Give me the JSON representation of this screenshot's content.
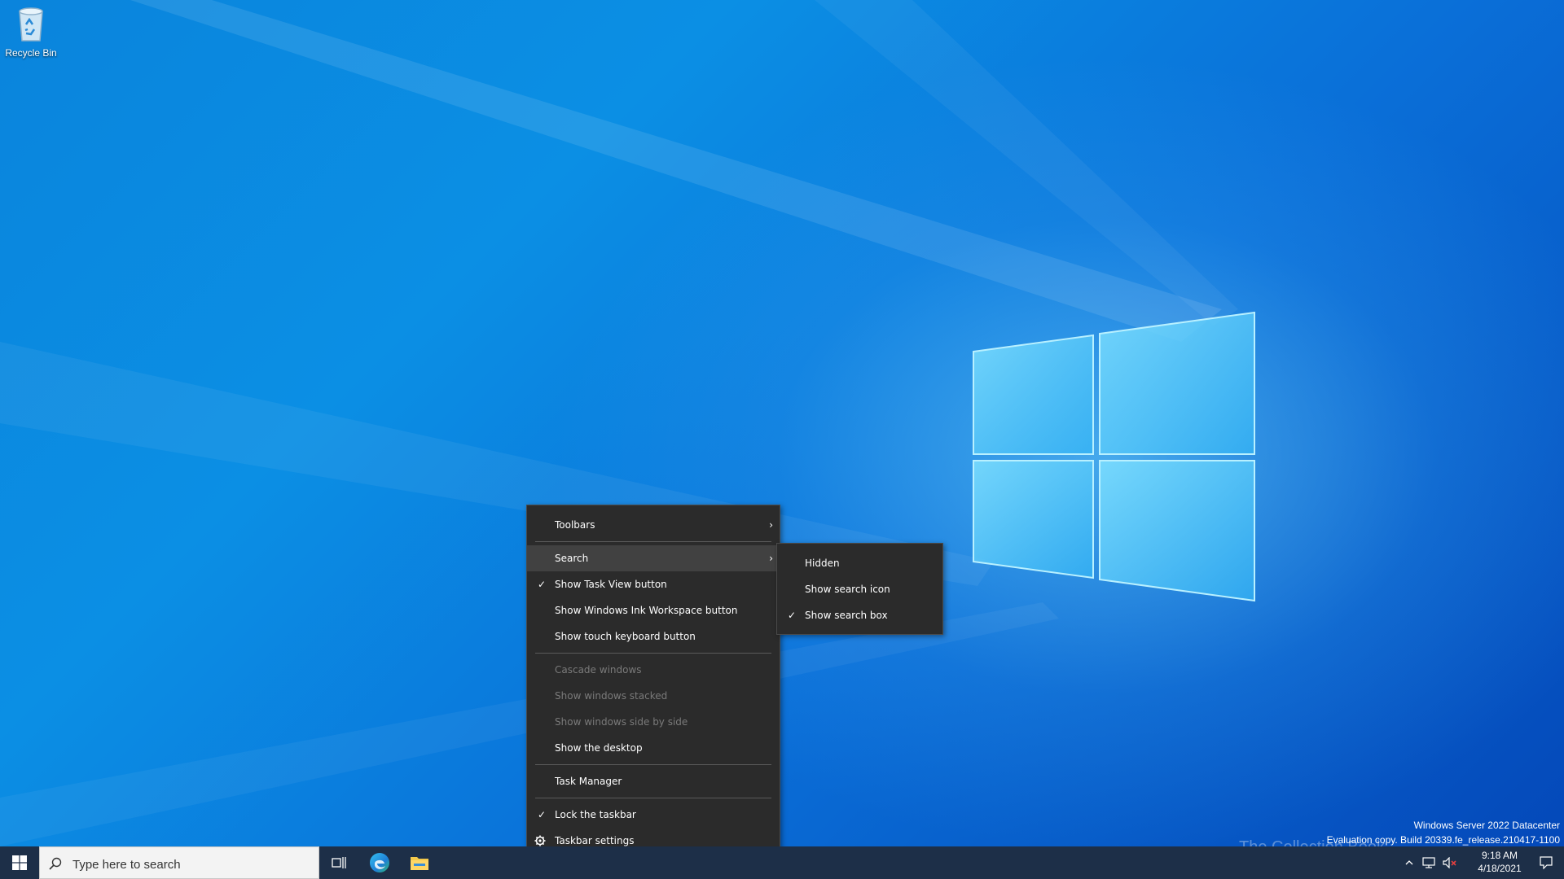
{
  "desktop": {
    "icons": [
      {
        "label": "Recycle Bin"
      }
    ]
  },
  "watermark": {
    "line1": "Windows Server 2022 Datacenter",
    "line2": "Evaluation copy. Build 20339.fe_release.210417-1100",
    "overlay_text": "The Collection Book"
  },
  "context_menu": {
    "items": [
      {
        "label": "Toolbars",
        "has_submenu": true
      },
      {
        "label": "Search",
        "has_submenu": true,
        "highlighted": true
      },
      {
        "label": "Show Task View button",
        "checked": true
      },
      {
        "label": "Show Windows Ink Workspace button"
      },
      {
        "label": "Show touch keyboard button"
      },
      {
        "label": "Cascade windows",
        "disabled": true
      },
      {
        "label": "Show windows stacked",
        "disabled": true
      },
      {
        "label": "Show windows side by side",
        "disabled": true
      },
      {
        "label": "Show the desktop"
      },
      {
        "label": "Task Manager"
      },
      {
        "label": "Lock the taskbar",
        "checked": true
      },
      {
        "label": "Taskbar settings",
        "icon": "gear-icon"
      }
    ],
    "check_glyph": "✓",
    "arrow_glyph": "›"
  },
  "search_submenu": {
    "items": [
      {
        "label": "Hidden"
      },
      {
        "label": "Show search icon"
      },
      {
        "label": "Show search box",
        "checked": true
      }
    ]
  },
  "taskbar": {
    "search_placeholder": "Type here to search",
    "pinned": [
      {
        "icon": "task-view-icon"
      },
      {
        "icon": "edge-icon"
      },
      {
        "icon": "file-explorer-icon"
      }
    ],
    "clock": {
      "time": "9:18 AM",
      "date": "4/18/2021"
    },
    "tray_icons": [
      "chevron-up-icon",
      "network-icon",
      "volume-muted-icon",
      "notification-icon"
    ]
  },
  "colors": {
    "accent": "#0a84dc",
    "menu_bg": "#2b2b2b",
    "taskbar_bg": "#1d2f48"
  }
}
